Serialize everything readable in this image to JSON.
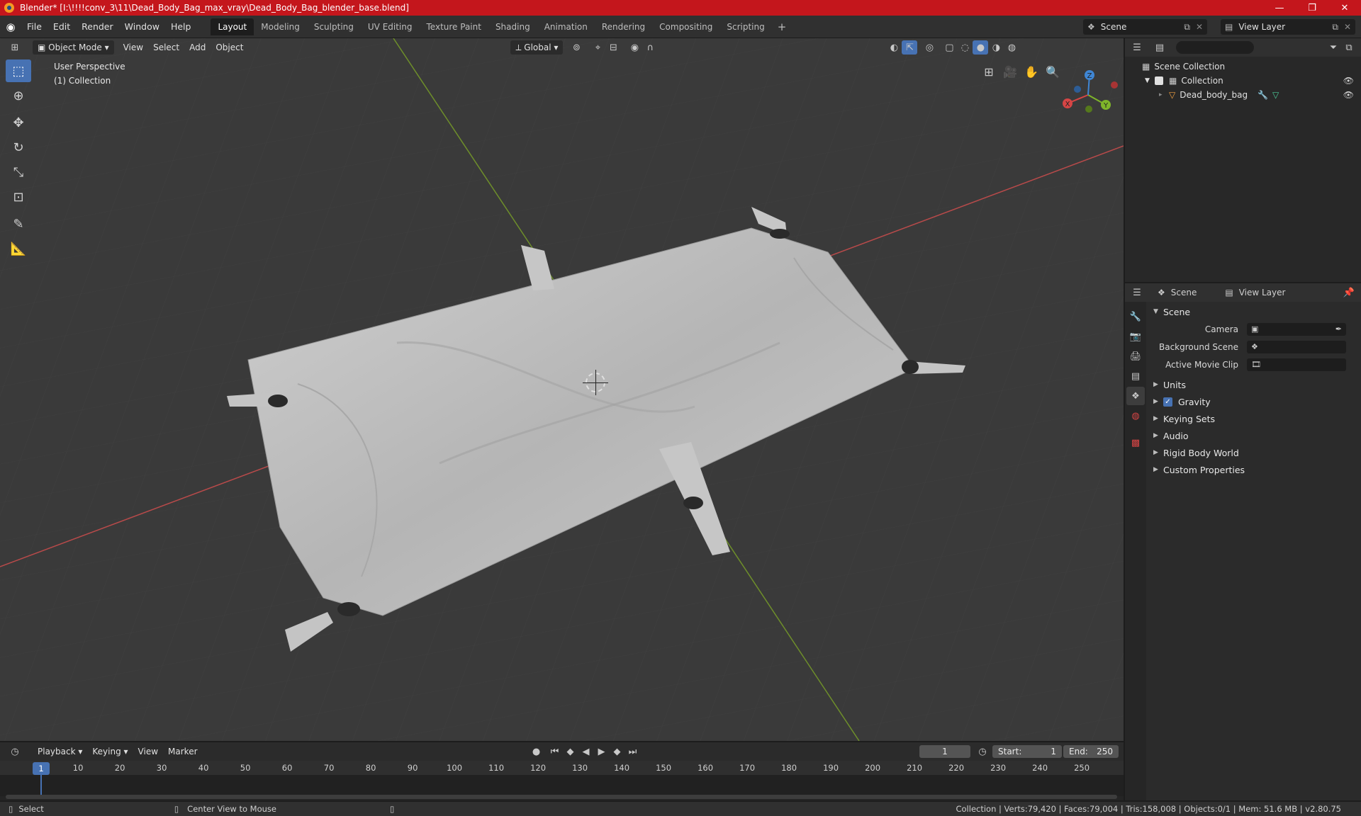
{
  "window": {
    "title": "Blender* [I:\\!!!!conv_3\\11\\Dead_Body_Bag_max_vray\\Dead_Body_Bag_blender_base.blend]",
    "minimize": "—",
    "maximize": "❐",
    "close": "✕"
  },
  "menu": [
    "File",
    "Edit",
    "Render",
    "Window",
    "Help"
  ],
  "workspaces": [
    "Layout",
    "Modeling",
    "Sculpting",
    "UV Editing",
    "Texture Paint",
    "Shading",
    "Animation",
    "Rendering",
    "Compositing",
    "Scripting"
  ],
  "workspace_add": "+",
  "scene_selector": {
    "value": "Scene",
    "view_layer": "View Layer"
  },
  "viewport": {
    "mode": "Object Mode",
    "menus": [
      "View",
      "Select",
      "Add",
      "Object"
    ],
    "orientation": "Global",
    "info_line1": "User Perspective",
    "info_line2": "(1) Collection"
  },
  "gizmo": {
    "x": "X",
    "y": "Y",
    "z": "Z"
  },
  "outliner": {
    "search_placeholder": "",
    "rows": [
      "Scene Collection",
      "Collection",
      "Dead_body_bag"
    ]
  },
  "properties": {
    "header_scene": "Scene",
    "header_view_layer": "View Layer",
    "panel_title": "Scene",
    "fields": [
      {
        "label": "Camera",
        "value": ""
      },
      {
        "label": "Background Scene",
        "value": ""
      },
      {
        "label": "Active Movie Clip",
        "value": ""
      }
    ],
    "subpanels": [
      "Units",
      "Gravity",
      "Keying Sets",
      "Audio",
      "Rigid Body World",
      "Custom Properties"
    ],
    "gravity_checked": true
  },
  "timeline": {
    "menus": [
      "Playback",
      "Keying",
      "View",
      "Marker"
    ],
    "current_frame": "1",
    "start_label": "Start:",
    "start_value": "1",
    "end_label": "End:",
    "end_value": "250",
    "ticks": [
      "1",
      "10",
      "20",
      "30",
      "40",
      "50",
      "60",
      "70",
      "80",
      "90",
      "100",
      "110",
      "120",
      "130",
      "140",
      "150",
      "160",
      "170",
      "180",
      "190",
      "200",
      "210",
      "220",
      "230",
      "240",
      "250"
    ]
  },
  "status": {
    "left_action": "Select",
    "middle_action": "Center View to Mouse",
    "stats": "Collection | Verts:79,420 | Faces:79,004 | Tris:158,008 | Objects:0/1 | Mem: 51.6 MB | v2.80.75"
  },
  "colors": {
    "title_bar": "#c4161c",
    "accent": "#4772b3",
    "x_axis": "#d64545",
    "y_axis": "#7fb52a",
    "z_axis": "#3f86d4"
  }
}
